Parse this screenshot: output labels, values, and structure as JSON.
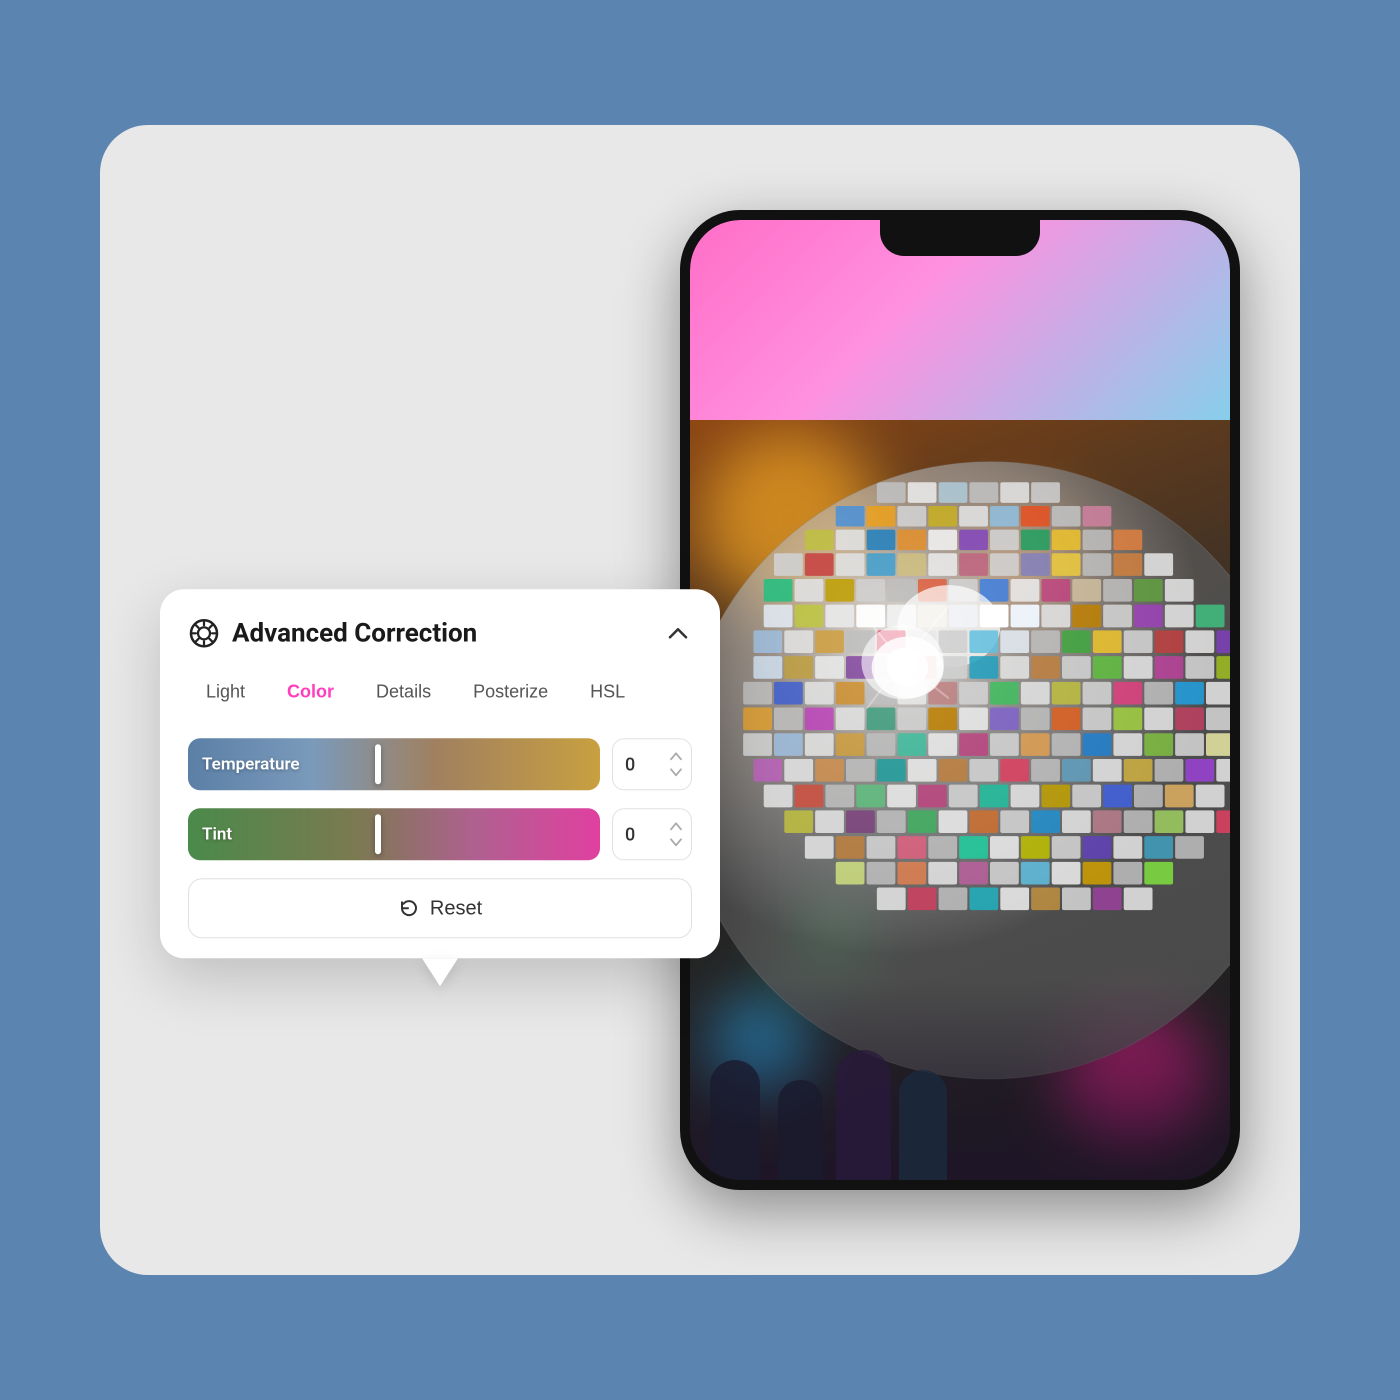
{
  "popup": {
    "title": "Advanced Correction",
    "collapse_label": "collapse",
    "tabs": [
      {
        "id": "light",
        "label": "Light",
        "active": false
      },
      {
        "id": "color",
        "label": "Color",
        "active": true
      },
      {
        "id": "details",
        "label": "Details",
        "active": false
      },
      {
        "id": "posterize",
        "label": "Posterize",
        "active": false
      },
      {
        "id": "hsl",
        "label": "HSL",
        "active": false
      }
    ],
    "sliders": [
      {
        "id": "temperature",
        "label": "Temperature",
        "value": "0"
      },
      {
        "id": "tint",
        "label": "Tint",
        "value": "0"
      }
    ],
    "reset_button": "Reset"
  },
  "phone": {
    "alt": "Phone showing disco ball photo"
  },
  "colors": {
    "active_tab": "#ff3dbd",
    "background_outer": "#5b84b1",
    "card_bg": "#e8e8e8"
  }
}
